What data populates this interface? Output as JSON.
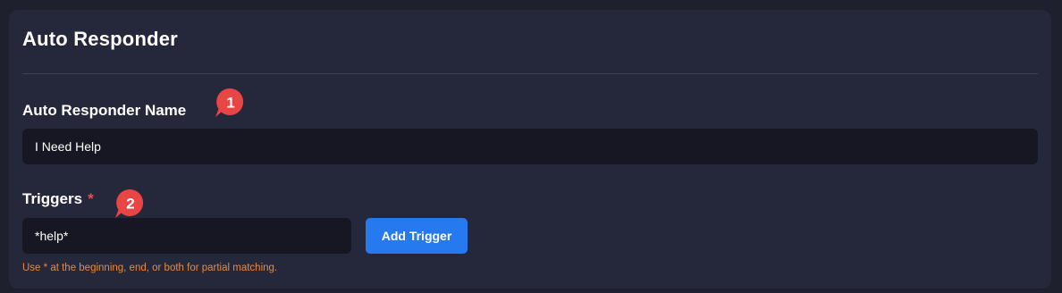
{
  "panel": {
    "title": "Auto Responder"
  },
  "form": {
    "name_label": "Auto Responder Name",
    "name_value": "I Need Help",
    "triggers_label": "Triggers",
    "required_mark": "*",
    "trigger_value": "*help*",
    "add_trigger_label": "Add Trigger",
    "hint": "Use * at the beginning, end, or both for partial matching."
  },
  "annotations": {
    "marker_1": "1",
    "marker_2": "2"
  },
  "colors": {
    "page_bg": "#1f202d",
    "panel_bg": "#25273a",
    "input_bg": "#161722",
    "accent_blue": "#2779f0",
    "required_red": "#e8504f",
    "hint_orange": "#e98a3c",
    "marker_red": "#e84545"
  }
}
